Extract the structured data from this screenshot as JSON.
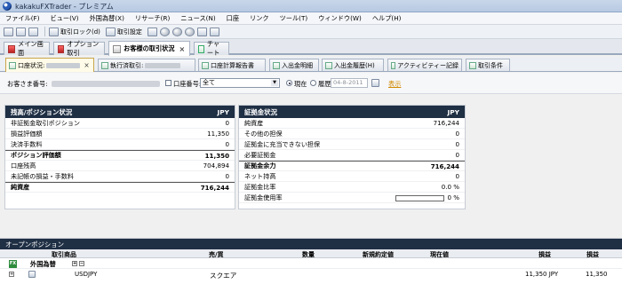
{
  "window": {
    "title": "kakakuFXTrader - プレミアム"
  },
  "menu": [
    "ファイル(F)",
    "ビュー(V)",
    "外国為替(X)",
    "リサーチ(R)",
    "ニュース(N)",
    "口座",
    "リンク",
    "ツール(T)",
    "ウィンドウ(W)",
    "ヘルプ(H)"
  ],
  "toolbar": {
    "trade_lock": "取引ロック(d)",
    "trade_settings": "取引設定"
  },
  "window_tabs": [
    {
      "label": "メイン画面"
    },
    {
      "label": "オプション取引"
    },
    {
      "label": "お客様の取引状況"
    },
    {
      "label": "チャート"
    }
  ],
  "sub_tabs": [
    {
      "label": "口座状況:"
    },
    {
      "label": "執行済取引:"
    },
    {
      "label": "口座計算報告書"
    },
    {
      "label": "入出金明細"
    },
    {
      "label": "入出金履歴(H)"
    },
    {
      "label": "アクティビティー記録"
    },
    {
      "label": "取引条件"
    }
  ],
  "filter": {
    "customer_label": "お客さま番号:",
    "account_label": "口座番号:",
    "account_value": "全て",
    "current_label": "現在",
    "history_label": "履歴:",
    "history_date_placeholder": "04-8-2011",
    "display_link": "表示"
  },
  "balance_panel": {
    "title": "残高/ポジション状況",
    "currency": "JPY",
    "rows": [
      {
        "label": "非証拠金取引ポジション",
        "value": "0",
        "bold": false,
        "top": false
      },
      {
        "label": "損益評価額",
        "value": "11,350",
        "bold": false,
        "top": false
      },
      {
        "label": "決済手数料",
        "value": "0",
        "bold": false,
        "top": false
      },
      {
        "label": "ポジション評価額",
        "value": "11,350",
        "bold": true,
        "top": true
      },
      {
        "label": "口座残高",
        "value": "704,894",
        "bold": false,
        "top": false
      },
      {
        "label": "未記帳の損益・手数料",
        "value": "0",
        "bold": false,
        "top": false
      },
      {
        "label": "純資産",
        "value": "716,244",
        "bold": true,
        "top": true
      }
    ]
  },
  "margin_panel": {
    "title": "証拠金状況",
    "currency": "JPY",
    "rows": [
      {
        "label": "純資産",
        "value": "716,244",
        "bold": false,
        "top": false
      },
      {
        "label": "その他の担保",
        "value": "0",
        "bold": false,
        "top": false
      },
      {
        "label": "証拠金に充当できない担保",
        "value": "0",
        "bold": false,
        "top": false
      },
      {
        "label": "必要証拠金",
        "value": "0",
        "bold": false,
        "top": false
      },
      {
        "label": "証拠金余力",
        "value": "716,244",
        "bold": true,
        "top": true
      },
      {
        "label": "ネット持高",
        "value": "0",
        "bold": false,
        "top": false
      },
      {
        "label": "証拠金比率",
        "value": "0.0 %",
        "bold": false,
        "top": false
      },
      {
        "label": "証拠金使用率",
        "value": "0 %",
        "bold": false,
        "top": false,
        "bar": 0
      }
    ]
  },
  "open_positions": {
    "title": "オープンポジション",
    "columns": [
      "取引商品",
      "売/買",
      "数量",
      "新規約定値",
      "現在値",
      "損益",
      "損益"
    ],
    "group": {
      "icon": "FX",
      "label": "外国為替"
    },
    "line": {
      "symbol": "USDJPY",
      "side": "スクエア",
      "pnl": "11,350 JPY",
      "pnl2": "11,350"
    }
  }
}
